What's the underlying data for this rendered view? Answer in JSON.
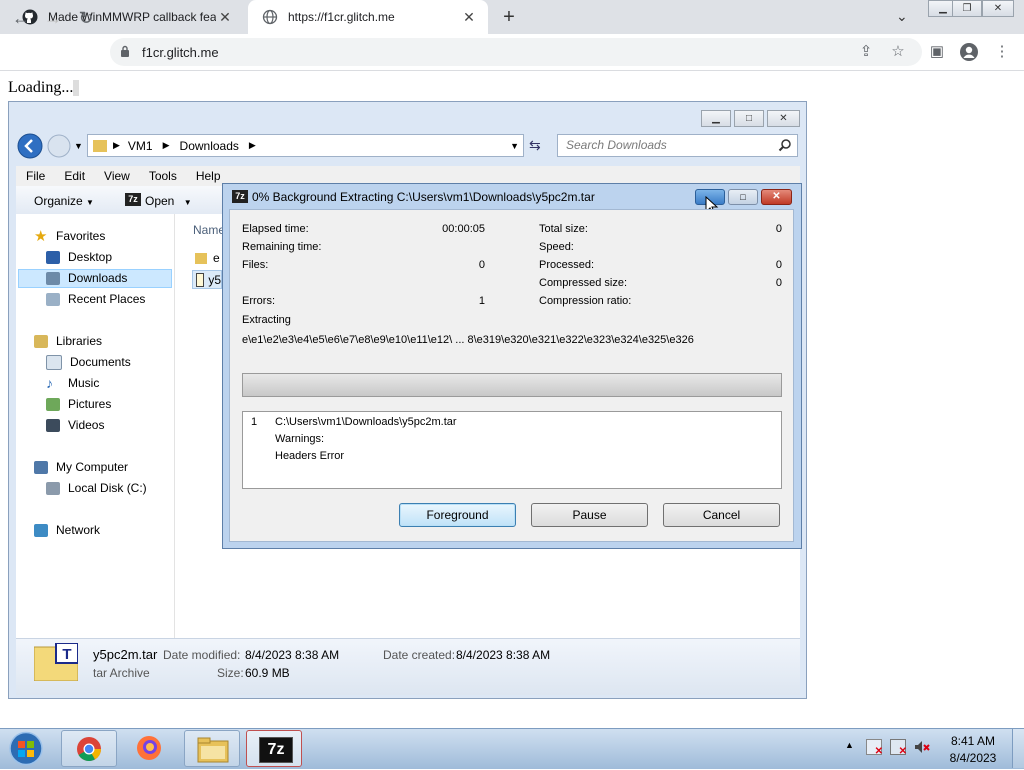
{
  "browser": {
    "tabs": [
      {
        "title": "Made WinMMWRP callback feat",
        "icon": "github-icon"
      },
      {
        "title": "https://f1cr.glitch.me",
        "icon": "globe-icon"
      }
    ],
    "url": "f1cr.glitch.me",
    "page_text": "Loading..."
  },
  "explorer": {
    "breadcrumb": [
      "VM1",
      "Downloads"
    ],
    "search_placeholder": "Search Downloads",
    "menu": [
      "File",
      "Edit",
      "View",
      "Tools",
      "Help"
    ],
    "commands": {
      "organize": "Organize",
      "open": "Open"
    },
    "nav": {
      "favorites": "Favorites",
      "desktop": "Desktop",
      "downloads": "Downloads",
      "recent": "Recent Places",
      "libraries": "Libraries",
      "documents": "Documents",
      "music": "Music",
      "pictures": "Pictures",
      "videos": "Videos",
      "computer": "My Computer",
      "local_disk": "Local Disk (C:)",
      "network": "Network"
    },
    "column_name": "Name",
    "files": [
      "e",
      "y5"
    ],
    "details": {
      "filename": "y5pc2m.tar",
      "type": "tar Archive",
      "modified_label": "Date modified:",
      "modified": "8/4/2023 8:38 AM",
      "created_label": "Date created:",
      "created": "8/4/2023 8:38 AM",
      "size_label": "Size:",
      "size": "60.9 MB"
    }
  },
  "dialog": {
    "title": "0% Background Extracting C:\\Users\\vm1\\Downloads\\y5pc2m.tar",
    "elapsed_label": "Elapsed time:",
    "elapsed": "00:00:05",
    "remaining_label": "Remaining time:",
    "files_label": "Files:",
    "files": "0",
    "errors_label": "Errors:",
    "errors": "1",
    "total_size_label": "Total size:",
    "total_size": "0",
    "speed_label": "Speed:",
    "processed_label": "Processed:",
    "processed": "0",
    "compressed_label": "Compressed size:",
    "compressed": "0",
    "ratio_label": "Compression ratio:",
    "extracting_label": "Extracting",
    "extracting_path": "e\\e1\\e2\\e3\\e4\\e5\\e6\\e7\\e8\\e9\\e10\\e11\\e12\\ ... 8\\e319\\e320\\e321\\e322\\e323\\e324\\e325\\e326",
    "progress": 0,
    "log": {
      "index": "1",
      "path": "C:\\Users\\vm1\\Downloads\\y5pc2m.tar",
      "line2": "Warnings:",
      "line3": "Headers Error"
    },
    "buttons": {
      "foreground": "Foreground",
      "pause": "Pause",
      "cancel": "Cancel"
    }
  },
  "taskbar": {
    "time": "8:41 AM",
    "date": "8/4/2023",
    "sevenzip_label": "7z"
  }
}
